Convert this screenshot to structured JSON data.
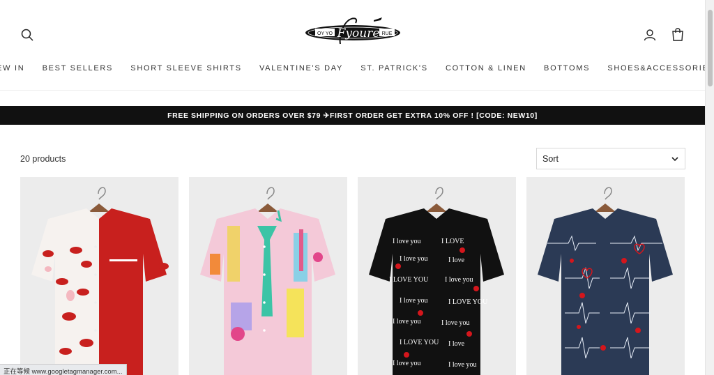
{
  "header": {
    "logo_text": "Fyoure",
    "logo_left": "OY YO",
    "logo_right": "RUE"
  },
  "nav": {
    "items": [
      {
        "label": "NEW IN"
      },
      {
        "label": "BEST SELLERS"
      },
      {
        "label": "SHORT SLEEVE SHIRTS"
      },
      {
        "label": "VALENTINE'S DAY"
      },
      {
        "label": "ST. PATRICK'S"
      },
      {
        "label": "COTTON & LINEN"
      },
      {
        "label": "BOTTOMS"
      },
      {
        "label": "SHOES&ACCESSORIES"
      }
    ]
  },
  "banner": {
    "text": "FREE SHIPPING ON ORDERS OVER $79 ✈FIRST ORDER GET EXTRA 10% OFF ! [CODE: NEW10]"
  },
  "collection": {
    "count": "20 products",
    "sort_label": "Sort"
  },
  "products": [
    {
      "name": "lips-red-split-shirt",
      "icon": "shirt-lips-print"
    },
    {
      "name": "city-collage-shirt",
      "icon": "shirt-city-print"
    },
    {
      "name": "i-love-you-black-shirt",
      "icon": "shirt-love-text-print"
    },
    {
      "name": "heartbeat-navy-shirt",
      "icon": "shirt-heartbeat-print"
    }
  ],
  "status": {
    "text": "正在等候 www.googletagmanager.com..."
  },
  "colors": {
    "banner_bg": "#111111",
    "card_bg": "#ececec",
    "accent_red": "#c8201e"
  }
}
